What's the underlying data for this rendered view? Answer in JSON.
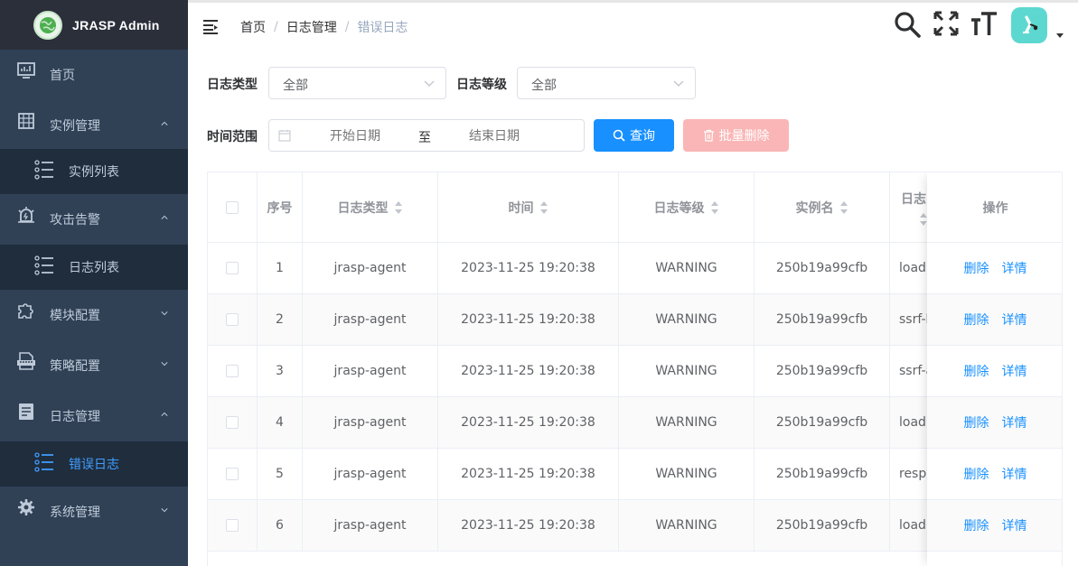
{
  "app": {
    "title": "JRASP Admin"
  },
  "sidebar": {
    "items": [
      {
        "label": "首页",
        "icon": "dashboard-icon"
      },
      {
        "label": "实例管理",
        "icon": "building-icon",
        "expanded": true,
        "children": [
          {
            "label": "实例列表",
            "icon": "list-icon"
          }
        ]
      },
      {
        "label": "攻击告警",
        "icon": "alarm-icon",
        "expanded": true,
        "children": [
          {
            "label": "日志列表",
            "icon": "list-icon"
          }
        ]
      },
      {
        "label": "模块配置",
        "icon": "puzzle-icon",
        "expanded": false
      },
      {
        "label": "策略配置",
        "icon": "json-file-icon",
        "expanded": false
      },
      {
        "label": "日志管理",
        "icon": "document-icon",
        "expanded": true,
        "children": [
          {
            "label": "错误日志",
            "icon": "list-icon",
            "active": true
          }
        ]
      },
      {
        "label": "系统管理",
        "icon": "gear-icon",
        "expanded": false
      }
    ]
  },
  "header": {
    "breadcrumb": [
      "首页",
      "日志管理",
      "错误日志"
    ],
    "breadcrumb_sep": "/"
  },
  "filters": {
    "log_type_label": "日志类型",
    "log_type_value": "全部",
    "log_level_label": "日志等级",
    "log_level_value": "全部",
    "time_range_label": "时间范围",
    "start_placeholder": "开始日期",
    "range_separator": "至",
    "end_placeholder": "结束日期",
    "query_label": "查询",
    "batch_delete_label": "批量删除"
  },
  "table": {
    "columns": [
      "序号",
      "日志类型",
      "时间",
      "日志等级",
      "实例名",
      "日志",
      "操作"
    ],
    "rows": [
      {
        "index": "1",
        "type": "jrasp-agent",
        "time": "2023-11-25 19:20:38",
        "level": "WARNING",
        "instance": "250b19a99cfb",
        "log": "loadi"
      },
      {
        "index": "2",
        "type": "jrasp-agent",
        "time": "2023-11-25 19:20:38",
        "level": "WARNING",
        "instance": "250b19a99cfb",
        "log": "ssrf-h"
      },
      {
        "index": "3",
        "type": "jrasp-agent",
        "time": "2023-11-25 19:20:38",
        "level": "WARNING",
        "instance": "250b19a99cfb",
        "log": "ssrf-a"
      },
      {
        "index": "4",
        "type": "jrasp-agent",
        "time": "2023-11-25 19:20:38",
        "level": "WARNING",
        "instance": "250b19a99cfb",
        "log": "loadi"
      },
      {
        "index": "5",
        "type": "jrasp-agent",
        "time": "2023-11-25 19:20:38",
        "level": "WARNING",
        "instance": "250b19a99cfb",
        "log": "respo"
      },
      {
        "index": "6",
        "type": "jrasp-agent",
        "time": "2023-11-25 19:20:38",
        "level": "WARNING",
        "instance": "250b19a99cfb",
        "log": "loadi"
      }
    ],
    "row_actions": {
      "delete": "删除",
      "detail": "详情"
    }
  },
  "colors": {
    "sidebar_bg": "#304156",
    "sidebar_sub_bg": "#1f2d3d",
    "accent": "#1890ff",
    "active_menu": "#409eff",
    "danger_disabled": "#fab6b6",
    "avatar_bg": "#5dd8d0"
  }
}
